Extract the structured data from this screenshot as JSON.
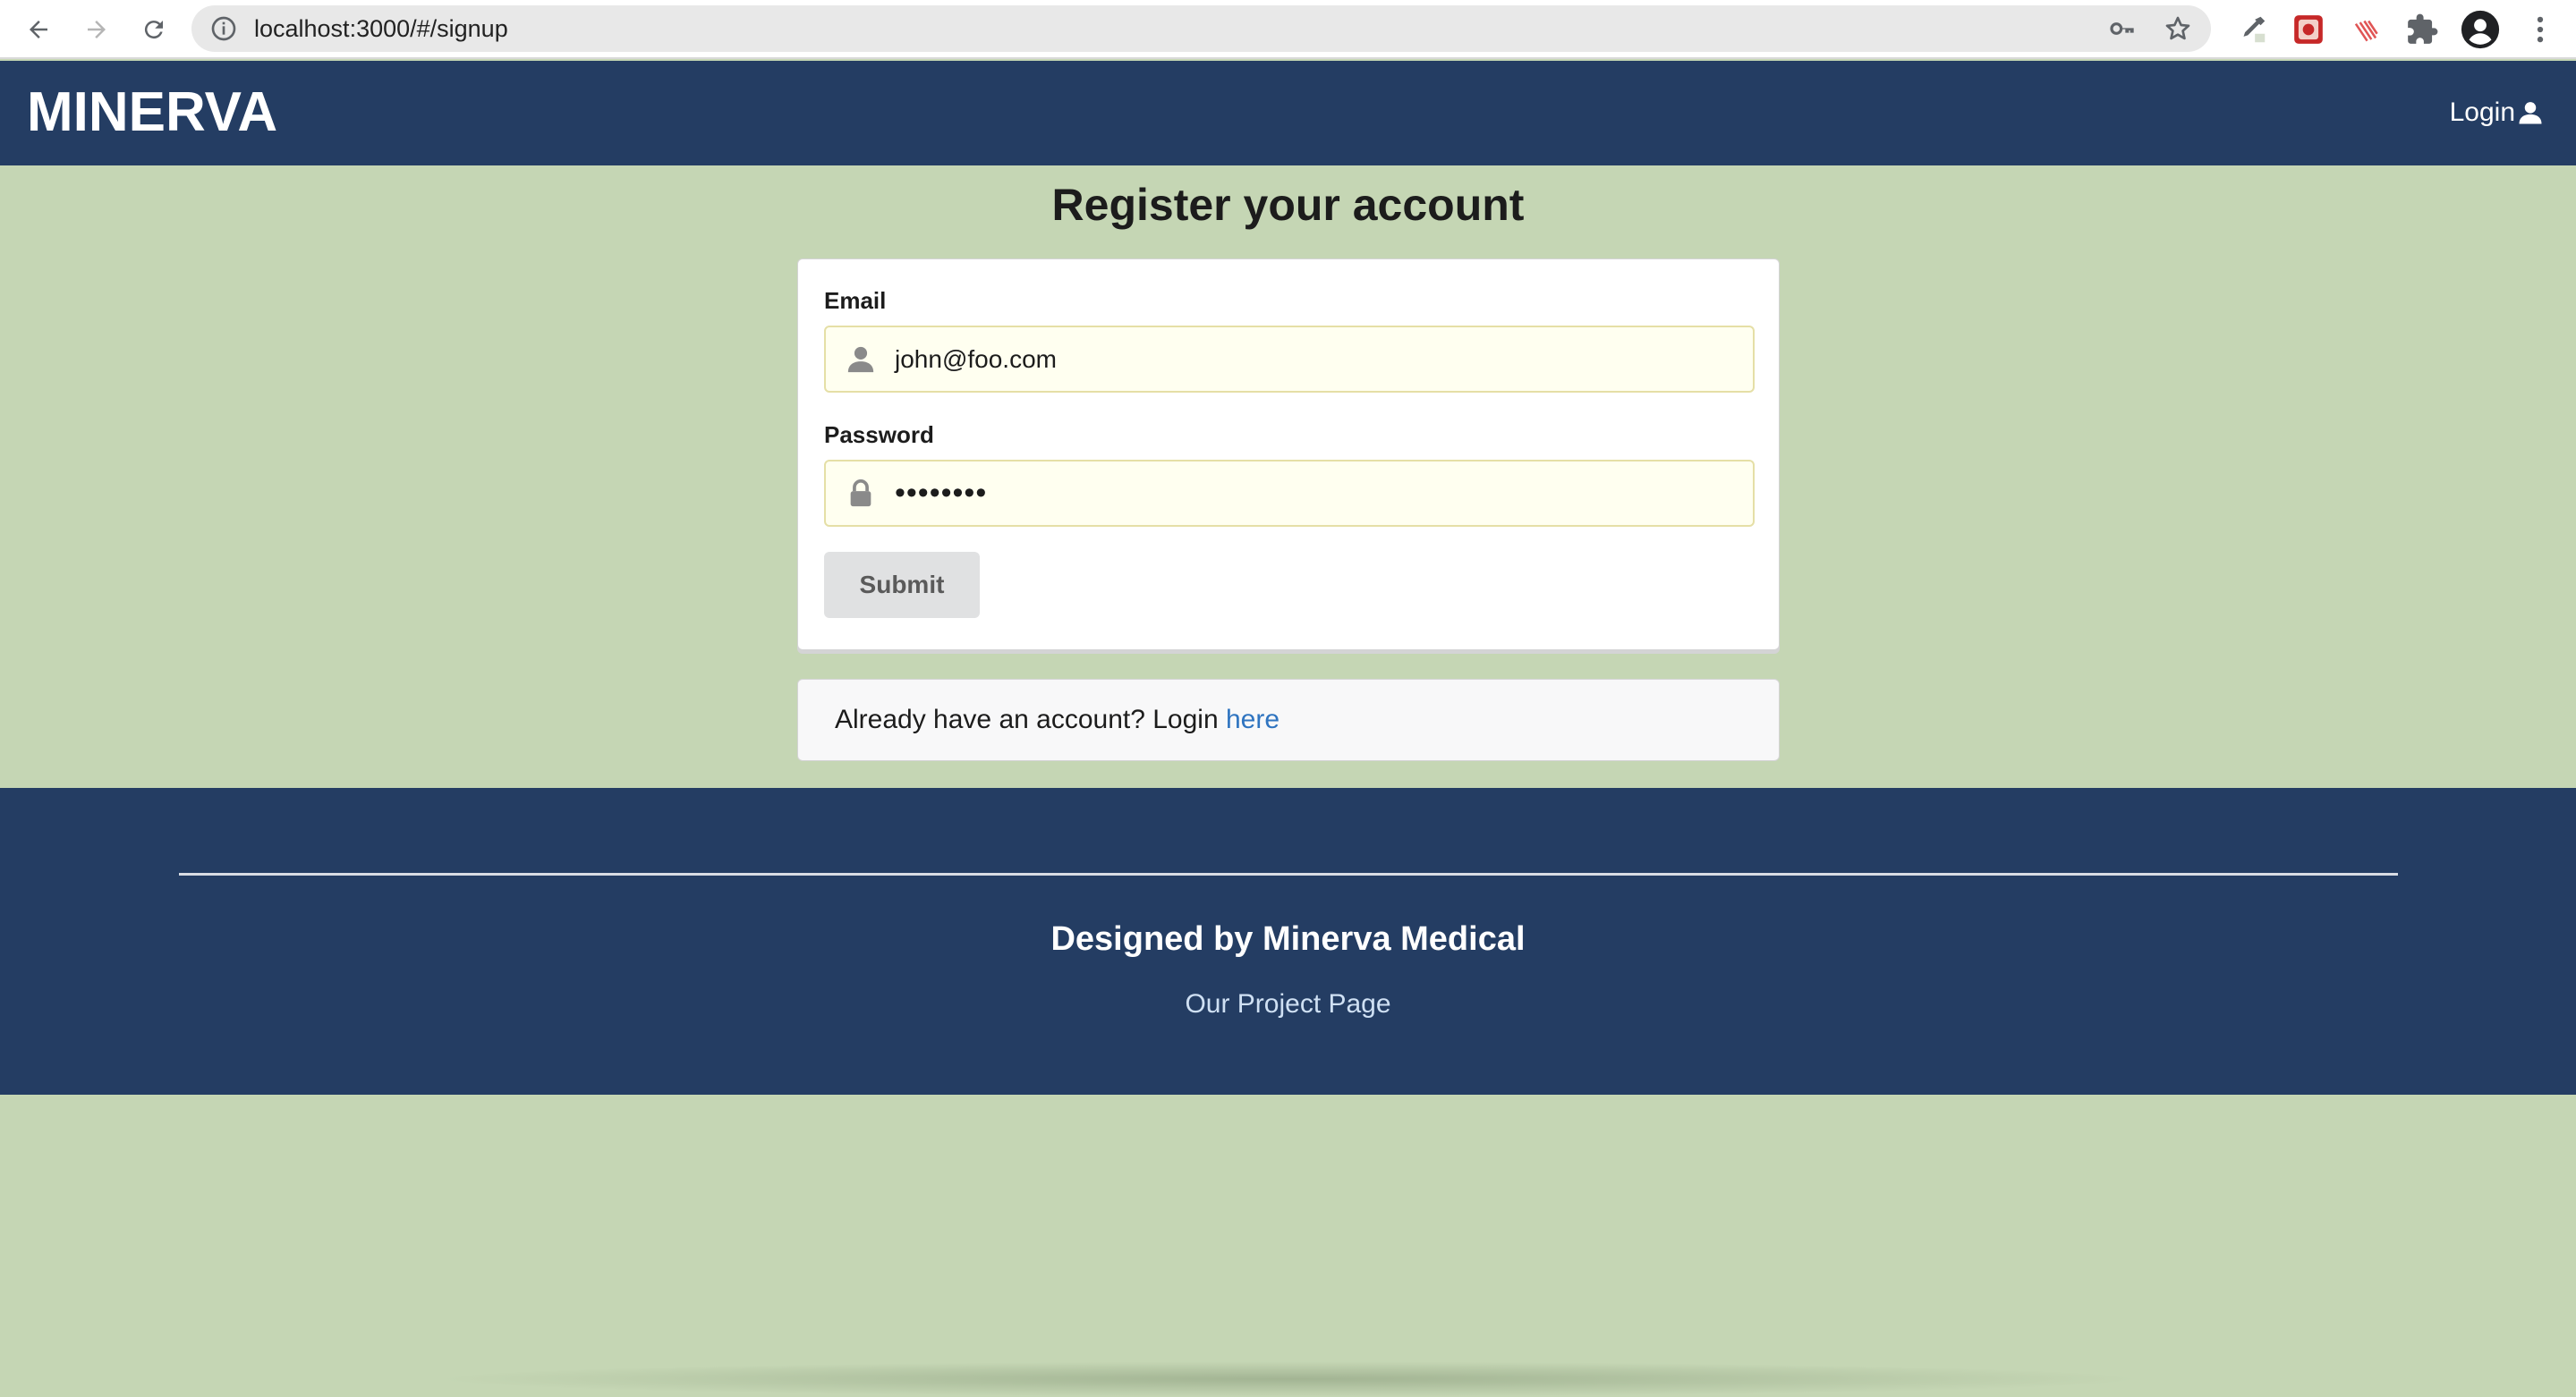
{
  "browser": {
    "url": "localhost:3000/#/signup",
    "icons": [
      "back-arrow-icon",
      "forward-arrow-icon",
      "reload-icon",
      "info-icon",
      "key-icon",
      "star-icon",
      "eyedropper-extension-icon",
      "red-extension-icon",
      "stripes-extension-icon",
      "puzzle-icon",
      "profile-icon",
      "more-icon"
    ]
  },
  "header": {
    "brand": "MINERVA",
    "login_label": "Login"
  },
  "main": {
    "title": "Register your account",
    "email_label": "Email",
    "email_value": "john@foo.com",
    "password_label": "Password",
    "password_value": "••••••••",
    "submit_label": "Submit",
    "already_text": "Already have an account? Login ",
    "here_link": "here"
  },
  "footer": {
    "title": "Designed by Minerva Medical",
    "link": "Our Project Page"
  },
  "colors": {
    "navy": "#243d63",
    "background": "#c5d6b4",
    "link": "#2f74c0",
    "autofill": "#fffff0"
  }
}
